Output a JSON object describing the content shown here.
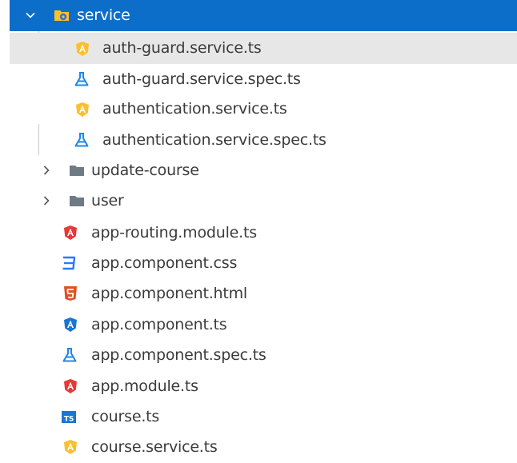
{
  "explorer": {
    "items": [
      {
        "label": "service",
        "kind": "folder-open",
        "icon": "service-folder-icon"
      },
      {
        "label": "auth-guard.service.ts",
        "kind": "file",
        "icon": "angular-service-icon"
      },
      {
        "label": "auth-guard.service.spec.ts",
        "kind": "file",
        "icon": "test-flask-icon"
      },
      {
        "label": "authentication.service.ts",
        "kind": "file",
        "icon": "angular-service-icon"
      },
      {
        "label": "authentication.service.spec.ts",
        "kind": "file",
        "icon": "test-flask-icon"
      },
      {
        "label": "update-course",
        "kind": "folder-closed",
        "icon": "folder-icon"
      },
      {
        "label": "user",
        "kind": "folder-closed",
        "icon": "folder-icon"
      },
      {
        "label": "app-routing.module.ts",
        "kind": "file",
        "icon": "angular-module-icon"
      },
      {
        "label": "app.component.css",
        "kind": "file",
        "icon": "css-icon"
      },
      {
        "label": "app.component.html",
        "kind": "file",
        "icon": "html5-icon"
      },
      {
        "label": "app.component.ts",
        "kind": "file",
        "icon": "angular-component-icon"
      },
      {
        "label": "app.component.spec.ts",
        "kind": "file",
        "icon": "test-flask-icon"
      },
      {
        "label": "app.module.ts",
        "kind": "file",
        "icon": "angular-module-icon"
      },
      {
        "label": "course.ts",
        "kind": "file",
        "icon": "typescript-icon"
      },
      {
        "label": "course.service.ts",
        "kind": "file",
        "icon": "angular-service-icon"
      }
    ],
    "ts_badge": "TS",
    "colors": {
      "selection": "#0d6ec9",
      "hover": "#e7e7e7",
      "angular_red": "#e53935",
      "angular_blue": "#1976d2",
      "service_yellow": "#fbc02d",
      "test_blue": "#1e88e5",
      "css_blue": "#2979ff",
      "html_orange": "#e44d26",
      "ts_blue": "#1976d2",
      "folder_gray": "#6e7b85"
    }
  }
}
